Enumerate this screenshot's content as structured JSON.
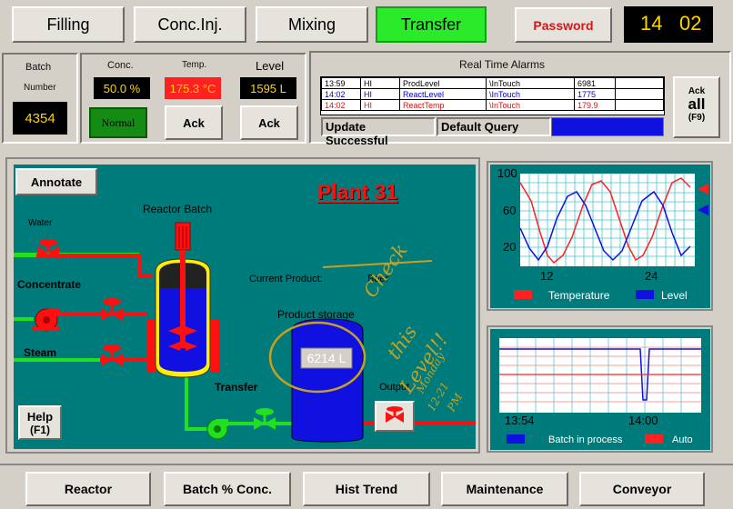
{
  "nav": {
    "filling": "Filling",
    "conc_inj": "Conc.Inj.",
    "mixing": "Mixing",
    "transfer": "Transfer"
  },
  "password": "Password",
  "clock": {
    "hour": "14",
    "minute": "02"
  },
  "batch": {
    "label_line1": "Batch",
    "label_line2": "Number",
    "value": "4354"
  },
  "conc": {
    "label": "Conc.",
    "value": "50.0 %",
    "status": "Normal"
  },
  "temp": {
    "label": "Temp.",
    "value": "175.3 °C",
    "ack": "Ack"
  },
  "level": {
    "label": "Level",
    "value": "1595 L",
    "ack": "Ack"
  },
  "alarms": {
    "title": "Real Time Alarms",
    "rows": [
      {
        "time": "13:59",
        "pri": "HI",
        "tag": "ProdLevel",
        "src": "\\InTouch",
        "val": "6981"
      },
      {
        "time": "14:02",
        "pri": "HI",
        "tag": "ReactLevel",
        "src": "\\InTouch",
        "val": "1775"
      },
      {
        "time": "14:02",
        "pri": "HI",
        "tag": "ReactTemp",
        "src": "\\InTouch",
        "val": "179.9"
      }
    ],
    "status": "Update Successful",
    "query": "Default Query",
    "ack_all": {
      "line1": "Ack",
      "line2": "all",
      "line3": "(F9)"
    }
  },
  "process": {
    "annotate": "Annotate",
    "plant": "Plant 31",
    "reactor_label": "Reactor Batch",
    "water": "Water",
    "concentrate": "Concentrate",
    "steam": "Steam",
    "current_product_label": "Current Product:",
    "current_product": "Beer",
    "storage_label": "Product storage",
    "storage_value": "6214 L",
    "transfer": "Transfer",
    "output": "Output",
    "help": {
      "line1": "Help",
      "line2": "(F1)"
    },
    "note": [
      "Check",
      "this",
      "Level!!",
      "Monday",
      "12-21",
      "PM"
    ]
  },
  "trend1": {
    "ticks_y": [
      "100",
      "60",
      "20"
    ],
    "ticks_x": [
      "12",
      "24"
    ],
    "legend": [
      "Temperature",
      "Level"
    ]
  },
  "trend2": {
    "ticks_x": [
      "13:54",
      "14:00"
    ],
    "legend": [
      "Batch in process",
      "Auto"
    ]
  },
  "bottom": {
    "reactor": "Reactor",
    "batch_conc": "Batch % Conc.",
    "hist_trend": "Hist Trend",
    "maintenance": "Maintenance",
    "conveyor": "Conveyor"
  },
  "colors": {
    "teal": "#007b7b",
    "alarm_red": "#d01818",
    "nav_active": "#2aea2a",
    "blue": "#1010e0"
  }
}
